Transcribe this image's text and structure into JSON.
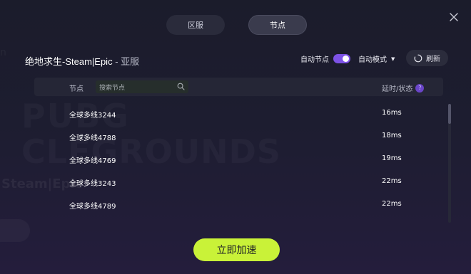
{
  "tabs": [
    {
      "label": "区服",
      "active": false
    },
    {
      "label": "节点",
      "active": true
    }
  ],
  "header": {
    "game_title": "绝地求生-Steam|Epic",
    "region": " - 亚服",
    "auto_node_label": "自动节点",
    "auto_node_on": true,
    "auto_mode_label": "自动模式",
    "refresh_label": "刷新"
  },
  "table": {
    "col_node": "节点",
    "search_placeholder": "搜索节点",
    "col_latency": "延时/状态",
    "rows": [
      {
        "name": "全球多线3244",
        "latency": "16ms"
      },
      {
        "name": "全球多线4788",
        "latency": "18ms"
      },
      {
        "name": "全球多线4769",
        "latency": "19ms"
      },
      {
        "name": "全球多线3243",
        "latency": "22ms"
      },
      {
        "name": "全球多线4789",
        "latency": "22ms"
      }
    ]
  },
  "accelerate_label": "立即加速",
  "colors": {
    "accent_purple": "#7d52e6",
    "accent_lime": "#c9f238",
    "background": "#1d1d30"
  }
}
